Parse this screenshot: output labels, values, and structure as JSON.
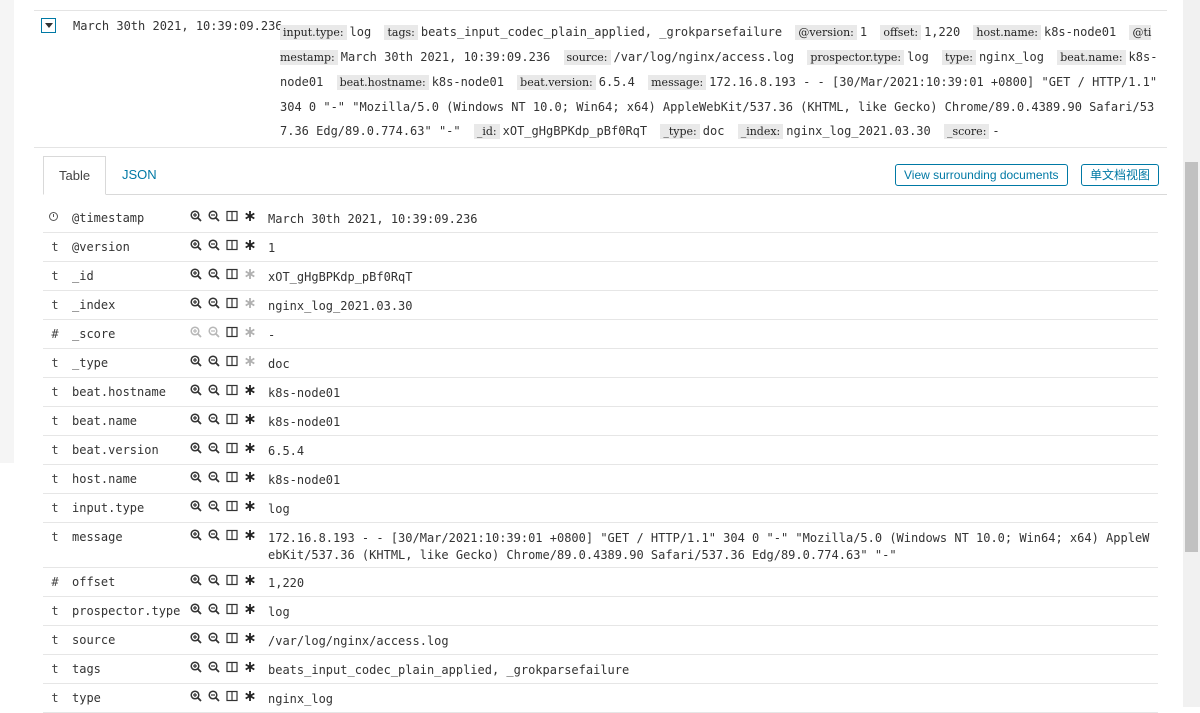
{
  "row": {
    "timestamp": "March 30th 2021, 10:39:09.236",
    "summary": [
      {
        "key": "input.type:",
        "value": "log"
      },
      {
        "key": "tags:",
        "value": "beats_input_codec_plain_applied, _grokparsefailure"
      },
      {
        "key": "@version:",
        "value": "1"
      },
      {
        "key": "offset:",
        "value": "1,220"
      },
      {
        "key": "host.name:",
        "value": "k8s-node01"
      },
      {
        "key": "@timestamp:",
        "value": "March 30th 2021, 10:39:09.236"
      },
      {
        "key": "source:",
        "value": "/var/log/nginx/access.log"
      },
      {
        "key": "prospector.type:",
        "value": "log"
      },
      {
        "key": "type:",
        "value": "nginx_log"
      },
      {
        "key": "beat.name:",
        "value": "k8s-node01"
      },
      {
        "key": "beat.hostname:",
        "value": "k8s-node01"
      },
      {
        "key": "beat.version:",
        "value": "6.5.4"
      },
      {
        "key": "message:",
        "value": "172.16.8.193 - - [30/Mar/2021:10:39:01 +0800] \"GET / HTTP/1.1\" 304 0 \"-\" \"Mozilla/5.0 (Windows NT 10.0; Win64; x64) AppleWebKit/537.36 (KHTML, like Gecko) Chrome/89.0.4389.90 Safari/537.36 Edg/89.0.774.63\" \"-\""
      },
      {
        "key": "_id:",
        "value": "xOT_gHgBPKdp_pBf0RqT"
      },
      {
        "key": "_type:",
        "value": "doc"
      },
      {
        "key": "_index:",
        "value": "nginx_log_2021.03.30"
      },
      {
        "key": "_score:",
        "value": "-"
      }
    ]
  },
  "tabs": [
    {
      "label": "Table",
      "active": true
    },
    {
      "label": "JSON",
      "active": false
    }
  ],
  "buttons": {
    "surrounding": "View surrounding documents",
    "single": "单文档视图"
  },
  "icons": {
    "filter_for": "magnifier-plus-icon",
    "filter_out": "magnifier-minus-icon",
    "toggle_column": "column-icon",
    "exists": "asterisk-icon",
    "type_date": "clock-icon"
  },
  "colors": {
    "accent": "#0079a5"
  },
  "fields": [
    {
      "type": "clock",
      "name": "@timestamp",
      "value": "March 30th 2021, 10:39:09.236"
    },
    {
      "type": "t",
      "name": "@version",
      "value": "1"
    },
    {
      "type": "t",
      "name": "_id",
      "value": "xOT_gHgBPKdp_pBf0RqT"
    },
    {
      "type": "t",
      "name": "_index",
      "value": "nginx_log_2021.03.30"
    },
    {
      "type": "#",
      "name": "_score",
      "value": " -"
    },
    {
      "type": "t",
      "name": "_type",
      "value": "doc"
    },
    {
      "type": "t",
      "name": "beat.hostname",
      "value": "k8s-node01"
    },
    {
      "type": "t",
      "name": "beat.name",
      "value": "k8s-node01"
    },
    {
      "type": "t",
      "name": "beat.version",
      "value": "6.5.4"
    },
    {
      "type": "t",
      "name": "host.name",
      "value": "k8s-node01"
    },
    {
      "type": "t",
      "name": "input.type",
      "value": "log"
    },
    {
      "type": "t",
      "name": "message",
      "value": "172.16.8.193 - - [30/Mar/2021:10:39:01 +0800] \"GET / HTTP/1.1\" 304 0 \"-\" \"Mozilla/5.0 (Windows NT 10.0; Win64; x64) AppleWebKit/537.36 (KHTML, like Gecko) Chrome/89.0.4389.90 Safari/537.36 Edg/89.0.774.63\" \"-\""
    },
    {
      "type": "#",
      "name": "offset",
      "value": "1,220"
    },
    {
      "type": "t",
      "name": "prospector.type",
      "value": "log"
    },
    {
      "type": "t",
      "name": "source",
      "value": "/var/log/nginx/access.log"
    },
    {
      "type": "t",
      "name": "tags",
      "value": "beats_input_codec_plain_applied, _grokparsefailure"
    },
    {
      "type": "t",
      "name": "type",
      "value": "nginx_log"
    }
  ]
}
